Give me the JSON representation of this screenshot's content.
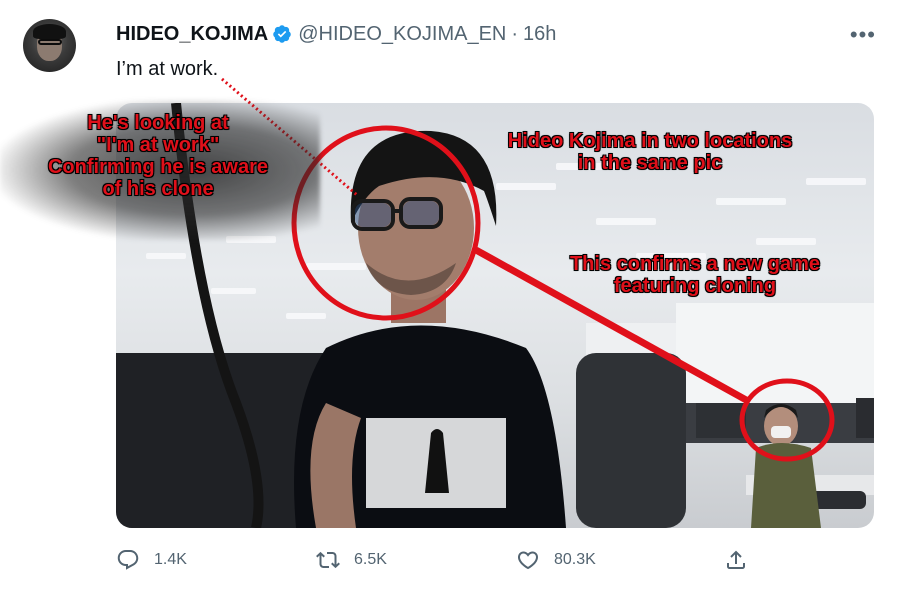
{
  "tweet": {
    "display_name": "HIDEO_KOJIMA",
    "handle": "@HIDEO_KOJIMA_EN",
    "separator": "·",
    "time": "16h",
    "more": "•••",
    "text": "I’m at work."
  },
  "annotations": {
    "looking": "He's looking at\n\"I'm at work\"\nConfirming he is aware\nof his clone",
    "two_locations": "Hideo Kojima in two locations\nin the same pic",
    "new_game": "This confirms a new game\nfeaturing cloning"
  },
  "actions": {
    "reply": {
      "icon": "reply-icon",
      "count": "1.4K"
    },
    "retweet": {
      "icon": "retweet-icon",
      "count": "6.5K"
    },
    "like": {
      "icon": "like-icon",
      "count": "80.3K"
    },
    "share": {
      "icon": "share-icon"
    }
  },
  "colors": {
    "verified": "#1d9bf0",
    "annotation_red": "#e0101a",
    "secondary_text": "#536471"
  }
}
